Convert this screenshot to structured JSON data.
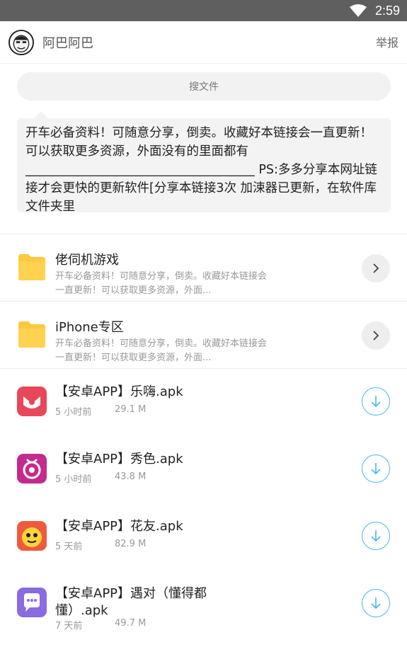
{
  "status_bar": {
    "time": "2:59"
  },
  "header": {
    "title": "阿巴阿巴",
    "report_label": "举报"
  },
  "search": {
    "placeholder": "搜文件"
  },
  "notice": {
    "text": "开车必备资料！可随意分享，倒卖。收藏好本链接会一直更新！可以获取更多资源，外面没有的里面都有_____________________________________ PS:多多分享本网址链接才会更快的更新软件[分享本链接3次 加涑器已更新，在软件库文件夹里"
  },
  "folders": [
    {
      "name": "佬伺机游戏",
      "desc": "开车必备资料！可随意分享，倒卖。收藏好本链接会一直更新！可以获取更多资源，外面...",
      "icon": "folder-icon"
    },
    {
      "name": "iPhone专区",
      "desc": "开车必备资料！可随意分享，倒卖。收藏好本链接会一直更新！可以获取更多资源，外面...",
      "icon": "folder-icon"
    }
  ],
  "files": [
    {
      "name": "【安卓APP】乐嗨.apk",
      "time": "5 小时前",
      "size": "29.1 M",
      "icon": "lehai-app-icon",
      "color": "#e8475a"
    },
    {
      "name": "【安卓APP】秀色.apk",
      "time": "5 小时前",
      "size": "43.8 M",
      "icon": "xiuse-app-icon",
      "color": "#c42b8f"
    },
    {
      "name": "【安卓APP】花友.apk",
      "time": "5 天前",
      "size": "82.9 M",
      "icon": "huayou-app-icon",
      "color": "#f05a3c"
    },
    {
      "name": "【安卓APP】遇对（懂得都懂）.apk",
      "time": "7 天前",
      "size": "49.7 M",
      "icon": "yudui-app-icon",
      "color": "#8a6be0"
    }
  ],
  "colors": {
    "accent": "#49b9e8",
    "folder": "#ffc93d",
    "status_bar": "#5f5f5f"
  }
}
